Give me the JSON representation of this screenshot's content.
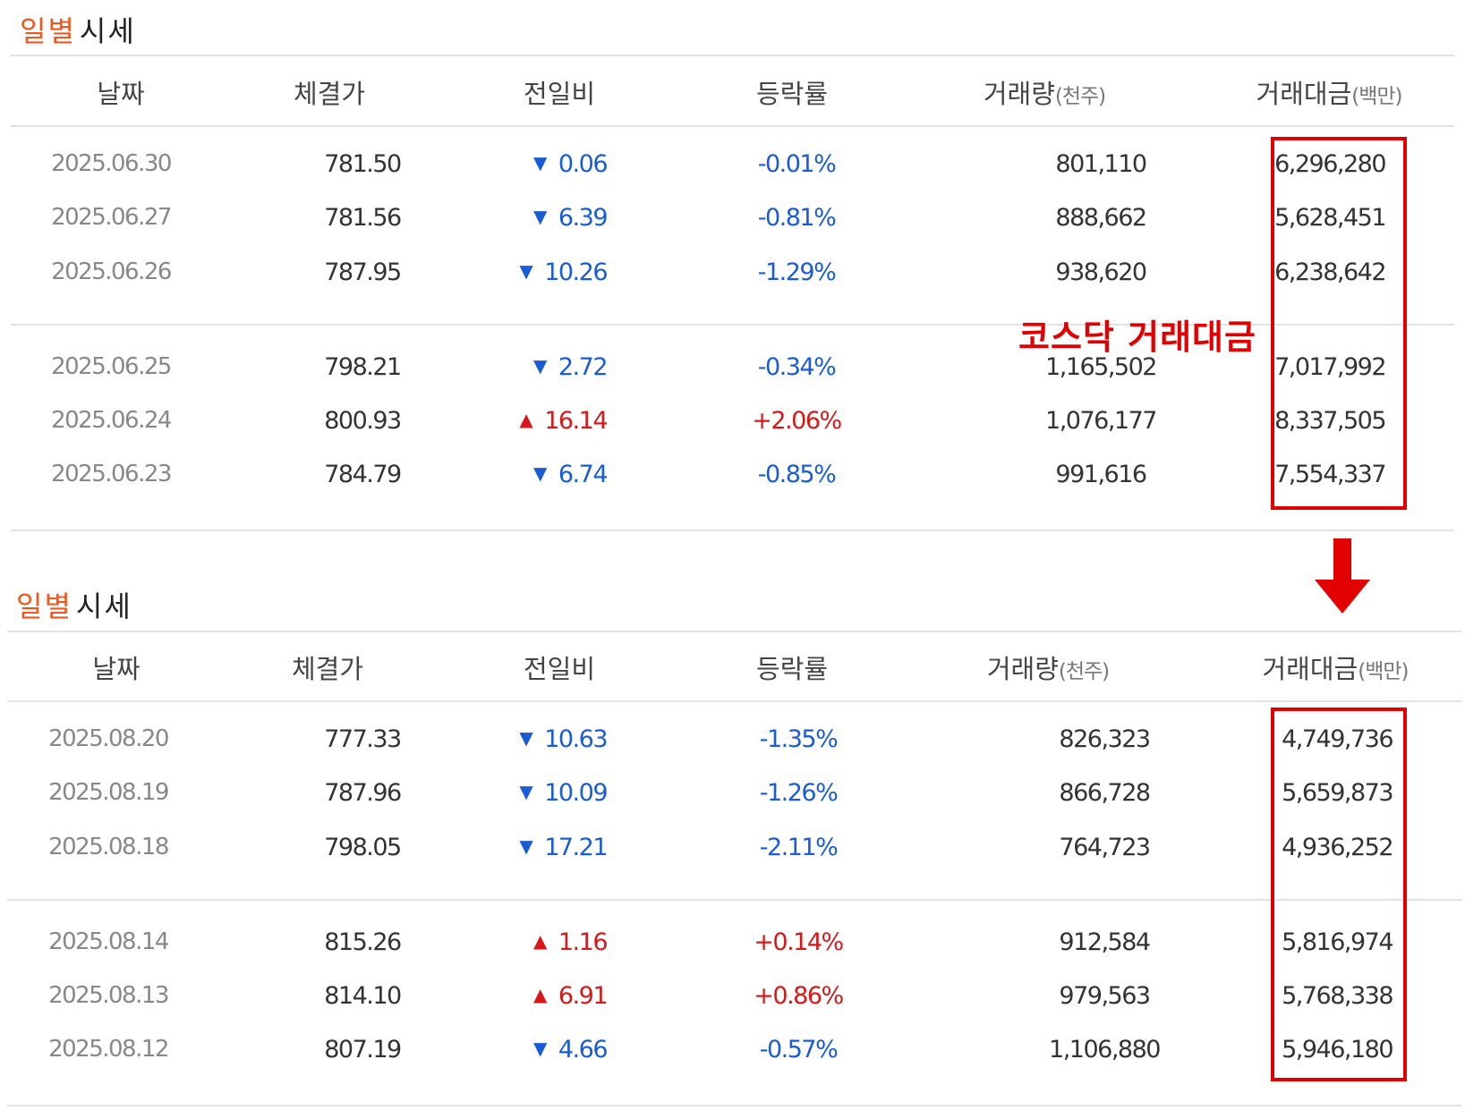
{
  "annotation": {
    "text": "코스닥 거래대금",
    "color": "#e30000"
  },
  "arrow_icon": "down-arrow-icon",
  "colors": {
    "title_accent": "#f0571f",
    "down": "#1a5bd6",
    "up": "#d81818",
    "highlight_box": "#e30000"
  },
  "tables": [
    {
      "title_accent": "일별",
      "title_rest": "시세",
      "headers": {
        "date": "날짜",
        "close": "체결가",
        "change": "전일비",
        "rate": "등락률",
        "volume": "거래량",
        "volume_unit": "(천주)",
        "amount": "거래대금",
        "amount_unit": "(백만)"
      },
      "groups": [
        [
          {
            "date": "2025.06.30",
            "close": "781.50",
            "dir": "down",
            "arrow": "▼",
            "change": "0.06",
            "rate": "-0.01%",
            "volume": "801,110",
            "amount": "6,296,280"
          },
          {
            "date": "2025.06.27",
            "close": "781.56",
            "dir": "down",
            "arrow": "▼",
            "change": "6.39",
            "rate": "-0.81%",
            "volume": "888,662",
            "amount": "5,628,451"
          },
          {
            "date": "2025.06.26",
            "close": "787.95",
            "dir": "down",
            "arrow": "▼",
            "change": "10.26",
            "rate": "-1.29%",
            "volume": "938,620",
            "amount": "6,238,642"
          }
        ],
        [
          {
            "date": "2025.06.25",
            "close": "798.21",
            "dir": "down",
            "arrow": "▼",
            "change": "2.72",
            "rate": "-0.34%",
            "volume": "1,165,502",
            "amount": "7,017,992"
          },
          {
            "date": "2025.06.24",
            "close": "800.93",
            "dir": "up",
            "arrow": "▲",
            "change": "16.14",
            "rate": "+2.06%",
            "volume": "1,076,177",
            "amount": "8,337,505"
          },
          {
            "date": "2025.06.23",
            "close": "784.79",
            "dir": "down",
            "arrow": "▼",
            "change": "6.74",
            "rate": "-0.85%",
            "volume": "991,616",
            "amount": "7,554,337"
          }
        ]
      ]
    },
    {
      "title_accent": "일별",
      "title_rest": "시세",
      "headers": {
        "date": "날짜",
        "close": "체결가",
        "change": "전일비",
        "rate": "등락률",
        "volume": "거래량",
        "volume_unit": "(천주)",
        "amount": "거래대금",
        "amount_unit": "(백만)"
      },
      "groups": [
        [
          {
            "date": "2025.08.20",
            "close": "777.33",
            "dir": "down",
            "arrow": "▼",
            "change": "10.63",
            "rate": "-1.35%",
            "volume": "826,323",
            "amount": "4,749,736"
          },
          {
            "date": "2025.08.19",
            "close": "787.96",
            "dir": "down",
            "arrow": "▼",
            "change": "10.09",
            "rate": "-1.26%",
            "volume": "866,728",
            "amount": "5,659,873"
          },
          {
            "date": "2025.08.18",
            "close": "798.05",
            "dir": "down",
            "arrow": "▼",
            "change": "17.21",
            "rate": "-2.11%",
            "volume": "764,723",
            "amount": "4,936,252"
          }
        ],
        [
          {
            "date": "2025.08.14",
            "close": "815.26",
            "dir": "up",
            "arrow": "▲",
            "change": "1.16",
            "rate": "+0.14%",
            "volume": "912,584",
            "amount": "5,816,974"
          },
          {
            "date": "2025.08.13",
            "close": "814.10",
            "dir": "up",
            "arrow": "▲",
            "change": "6.91",
            "rate": "+0.86%",
            "volume": "979,563",
            "amount": "5,768,338"
          },
          {
            "date": "2025.08.12",
            "close": "807.19",
            "dir": "down",
            "arrow": "▼",
            "change": "4.66",
            "rate": "-0.57%",
            "volume": "1,106,880",
            "amount": "5,946,180"
          }
        ]
      ]
    }
  ]
}
